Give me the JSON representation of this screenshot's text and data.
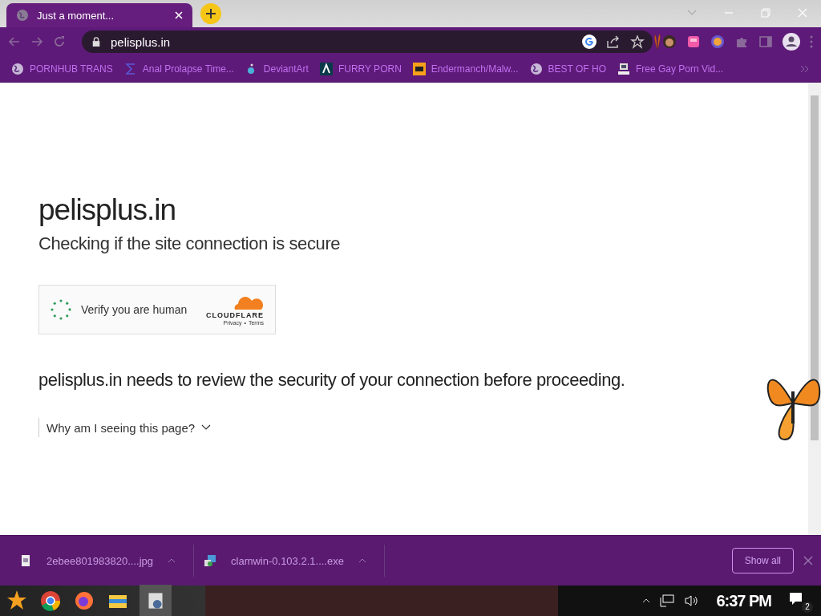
{
  "tab": {
    "title": "Just a moment..."
  },
  "address": {
    "url": "pelisplus.in"
  },
  "bookmarks": [
    {
      "label": "PORNHUB TRANS",
      "kind": "globe"
    },
    {
      "label": "Anal Prolapse Time...",
      "kind": "sigma"
    },
    {
      "label": "DeviantArt",
      "kind": "blob"
    },
    {
      "label": "FURRY PORN",
      "kind": "chevron"
    },
    {
      "label": "Endermanch/Malw...",
      "kind": "ph"
    },
    {
      "label": "BEST OF HO",
      "kind": "globe"
    },
    {
      "label": "Free Gay Porn Vid...",
      "kind": "computer"
    }
  ],
  "page": {
    "heading": "pelisplus.in",
    "subheading": "Checking if the site connection is secure",
    "widget": {
      "label": "Verify you are human",
      "brand": "CLOUDFLARE",
      "privacy": "Privacy",
      "separator": "•",
      "terms": "Terms"
    },
    "message": "pelisplus.in needs to review the security of your connection before proceeding.",
    "expander": {
      "label": "Why am I seeing this page?",
      "expanded": false
    }
  },
  "downloads": [
    {
      "name": "2ebee801983820....jpg",
      "kind": "image"
    },
    {
      "name": "clamwin-0.103.2.1....exe",
      "kind": "installer"
    }
  ],
  "show_all": "Show all",
  "taskbar": {
    "time": "6:37 PM",
    "notifications": "2"
  }
}
